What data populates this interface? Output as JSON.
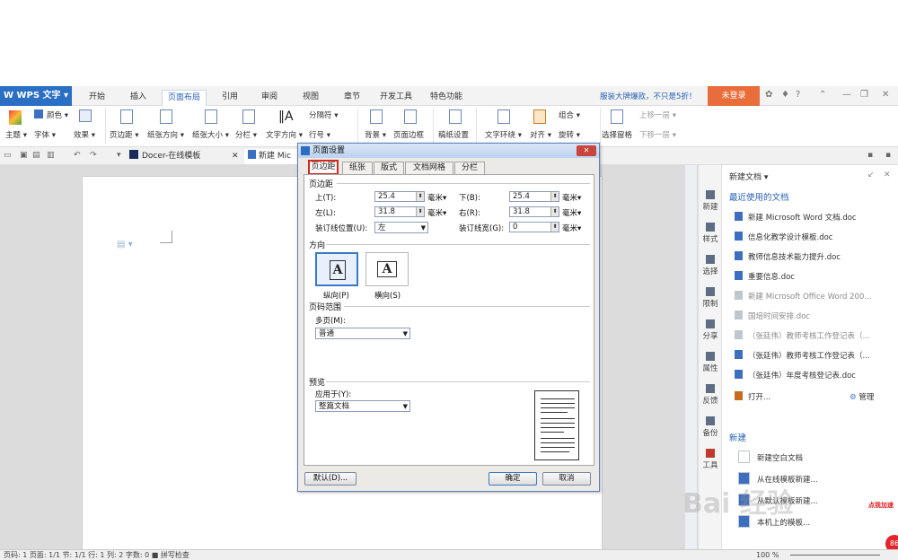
{
  "app": {
    "logo": "W WPS 文字 ▾"
  },
  "menu_tabs": [
    "开始",
    "插入",
    "页面布局",
    "引用",
    "审阅",
    "视图",
    "章节",
    "开发工具",
    "特色功能"
  ],
  "active_tab": "页面布局",
  "promo": "服装大牌爆款，不只是5折！",
  "login": "未登录",
  "ribbon": {
    "theme": "主题 ▾",
    "color": "颜色 ▾",
    "font": "字体 ▾",
    "effect": "效果 ▾",
    "margins": "页边距 ▾",
    "orientation": "纸张方向 ▾",
    "size": "纸张大小 ▾",
    "columns": "分栏 ▾",
    "text_direction": "文字方向 ▾",
    "separator": "分隔符 ▾",
    "line_no": "行号 ▾",
    "background": "背景 ▾",
    "page_border": "页面边框",
    "paper_setup": "稿纸设置",
    "wrap": "文字环绕 ▾",
    "align": "对齐 ▾",
    "group": "组合 ▾",
    "rotate": "旋转 ▾",
    "select_pane": "选择窗格",
    "bring_fwd": "上移一层 ▾",
    "send_back": "下移一层 ▾"
  },
  "doc_tabs": {
    "docer": "Docer-在线模板",
    "current": "新建 Mic"
  },
  "taskpane": {
    "header": "新建文档 ▾",
    "recent_title": "最近使用的文档",
    "recent": [
      {
        "name": "新建 Microsoft Word 文档.doc",
        "dim": false
      },
      {
        "name": "信息化教学设计模板.doc",
        "dim": false
      },
      {
        "name": "教师信息技术能力提升.doc",
        "dim": false
      },
      {
        "name": "重要信息.doc",
        "dim": false
      },
      {
        "name": "新建 Microsoft Office Word 200...",
        "dim": true
      },
      {
        "name": "国培时间安排.doc",
        "dim": true
      },
      {
        "name": "（张廷伟）教师考核工作登记表（...",
        "dim": true
      },
      {
        "name": "（张廷伟）教师考核工作登记表（...",
        "dim": false
      },
      {
        "name": "（张廷伟）年度考核登记表.doc",
        "dim": false
      }
    ],
    "open": "打开...",
    "manage": "管理",
    "new_title": "新建",
    "new_items": [
      "新建空白文档",
      "从在线模板新建...",
      "从默认模板新建...",
      "本机上的模板..."
    ]
  },
  "side_buttons": [
    "新建",
    "样式",
    "选择",
    "限制",
    "分享",
    "属性",
    "反馈",
    "备份",
    "工具"
  ],
  "status": "页码: 1  页面: 1/1  节: 1/1  行: 1  列: 2  字数: 0  ■ 拼写检查",
  "zoom": "100 %",
  "watermark": "Bai 经验",
  "corner_promo": "点我加速",
  "corner_badge": "86",
  "dialog": {
    "title": "页面设置",
    "tabs": [
      "页边距",
      "纸张",
      "版式",
      "文档网格",
      "分栏"
    ],
    "margins_group": "页边距",
    "top_label": "上(T):",
    "top_val": "25.4",
    "bottom_label": "下(B):",
    "bottom_val": "25.4",
    "left_label": "左(L):",
    "left_val": "31.8",
    "right_label": "右(R):",
    "right_val": "31.8",
    "unit": "毫米▾",
    "gutter_pos_label": "装订线位置(U):",
    "gutter_pos_val": "左",
    "gutter_width_label": "装订线宽(G):",
    "gutter_width_val": "0",
    "orientation_group": "方向",
    "portrait": "纵向(P)",
    "landscape": "横向(S)",
    "pages_group": "页码范围",
    "multi_label": "多页(M):",
    "multi_val": "普通",
    "preview_group": "预览",
    "apply_label": "应用于(Y):",
    "apply_val": "整篇文档",
    "default_btn": "默认(D)...",
    "ok_btn": "确定",
    "cancel_btn": "取消"
  }
}
